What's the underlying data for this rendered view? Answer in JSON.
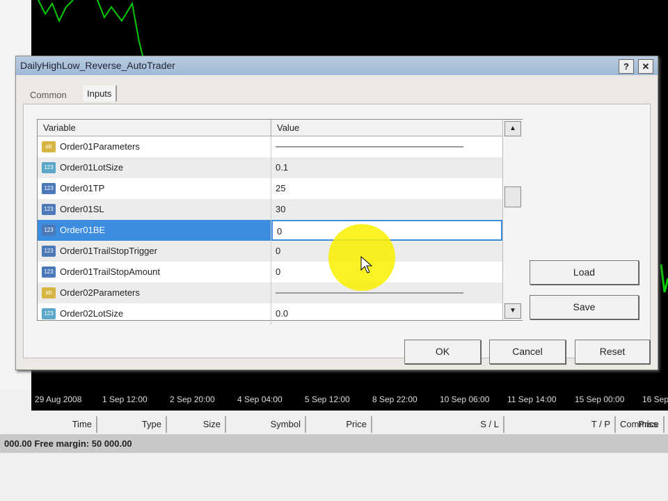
{
  "dialog": {
    "title": "DailyHighLow_Reverse_AutoTrader",
    "help": "?",
    "close": "✕",
    "tabs": [
      "Common",
      "Inputs"
    ],
    "columns": {
      "variable": "Variable",
      "value": "Value"
    },
    "rows": [
      {
        "name": "Order01Parameters",
        "value": "",
        "type": "p"
      },
      {
        "name": "Order01LotSize",
        "value": "0.1",
        "type": "d"
      },
      {
        "name": "Order01TP",
        "value": "25",
        "type": "n"
      },
      {
        "name": "Order01SL",
        "value": "30",
        "type": "n"
      },
      {
        "name": "Order01BE",
        "value": "0",
        "type": "n"
      },
      {
        "name": "Order01TrailStopTrigger",
        "value": "0",
        "type": "n"
      },
      {
        "name": "Order01TrailStopAmount",
        "value": "0",
        "type": "n"
      },
      {
        "name": "Order02Parameters",
        "value": "",
        "type": "p"
      },
      {
        "name": "Order02LotSize",
        "value": "0.0",
        "type": "d"
      }
    ],
    "load": "Load",
    "save": "Save",
    "ok": "OK",
    "cancel": "Cancel",
    "reset": "Reset"
  },
  "axis": [
    "29 Aug 2008",
    "1 Sep 12:00",
    "2 Sep 20:00",
    "4 Sep 04:00",
    "5 Sep 12:00",
    "8 Sep 22:00",
    "10 Sep 06:00",
    "11 Sep 14:00",
    "15 Sep 00:00",
    "16 Sep"
  ],
  "terminal": {
    "columns": [
      "Time",
      "Type",
      "Size",
      "Symbol",
      "Price",
      "S / L",
      "T / P",
      "Price",
      "Commiss"
    ],
    "status": "000.00  Free margin: 50 000.00"
  }
}
